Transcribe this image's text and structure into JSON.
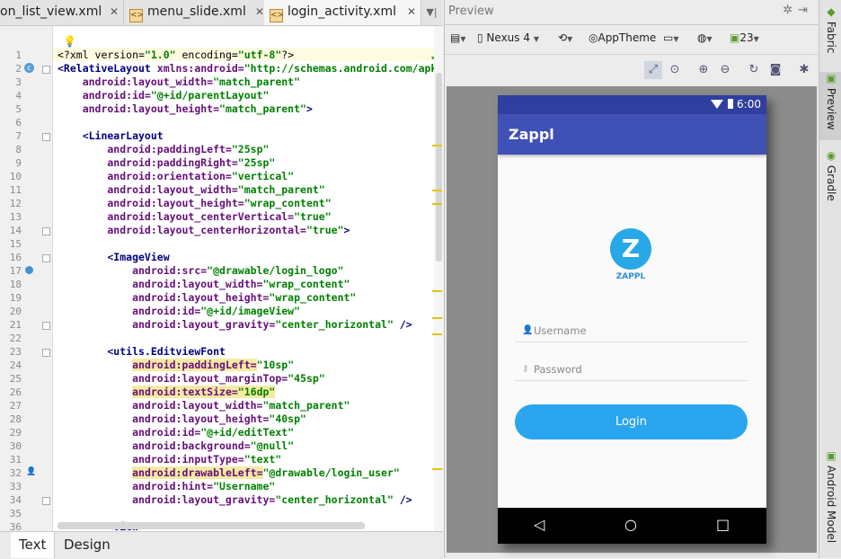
{
  "editor": {
    "tabs": [
      {
        "label": "on_list_view.xml",
        "active": false
      },
      {
        "label": "menu_slide.xml",
        "active": false
      },
      {
        "label": "login_activity.xml",
        "active": true
      }
    ],
    "lines": [
      {
        "n": "1",
        "segs": [
          {
            "t": "<?xml version=",
            "c": "pl"
          },
          {
            "t": "\"1.0\"",
            "c": "vl"
          },
          {
            "t": " encoding=",
            "c": "pl"
          },
          {
            "t": "\"utf-8\"",
            "c": "vl"
          },
          {
            "t": "?>",
            "c": "pl"
          }
        ]
      },
      {
        "n": "2",
        "segs": [
          {
            "t": "<RelativeLayout ",
            "c": "tg"
          },
          {
            "t": "xmlns:android=",
            "c": "at"
          },
          {
            "t": "\"http://schemas.android.com/apk",
            "c": "vl"
          }
        ]
      },
      {
        "n": "3",
        "segs": [
          {
            "t": "    android:layout_width=",
            "c": "at"
          },
          {
            "t": "\"match_parent\"",
            "c": "vl"
          }
        ]
      },
      {
        "n": "4",
        "segs": [
          {
            "t": "    android:id=",
            "c": "at"
          },
          {
            "t": "\"@+id/parentLayout\"",
            "c": "vl"
          }
        ]
      },
      {
        "n": "5",
        "segs": [
          {
            "t": "    android:layout_height=",
            "c": "at"
          },
          {
            "t": "\"match_parent\"",
            "c": "vl"
          },
          {
            "t": ">",
            "c": "tg"
          }
        ]
      },
      {
        "n": "6",
        "segs": []
      },
      {
        "n": "7",
        "segs": [
          {
            "t": "    <LinearLayout",
            "c": "tg"
          }
        ]
      },
      {
        "n": "8",
        "segs": [
          {
            "t": "        android:paddingLeft=",
            "c": "at"
          },
          {
            "t": "\"25sp\"",
            "c": "vl"
          }
        ]
      },
      {
        "n": "9",
        "segs": [
          {
            "t": "        android:paddingRight=",
            "c": "at"
          },
          {
            "t": "\"25sp\"",
            "c": "vl"
          }
        ]
      },
      {
        "n": "10",
        "segs": [
          {
            "t": "        android:orientation=",
            "c": "at"
          },
          {
            "t": "\"vertical\"",
            "c": "vl"
          }
        ]
      },
      {
        "n": "11",
        "segs": [
          {
            "t": "        android:layout_width=",
            "c": "at"
          },
          {
            "t": "\"match_parent\"",
            "c": "vl"
          }
        ]
      },
      {
        "n": "12",
        "segs": [
          {
            "t": "        android:layout_height=",
            "c": "at"
          },
          {
            "t": "\"wrap_content\"",
            "c": "vl"
          }
        ]
      },
      {
        "n": "13",
        "segs": [
          {
            "t": "        android:layout_centerVertical=",
            "c": "at"
          },
          {
            "t": "\"true\"",
            "c": "vl"
          }
        ]
      },
      {
        "n": "14",
        "segs": [
          {
            "t": "        android:layout_centerHorizontal=",
            "c": "at"
          },
          {
            "t": "\"true\"",
            "c": "vl"
          },
          {
            "t": ">",
            "c": "tg"
          }
        ]
      },
      {
        "n": "15",
        "segs": []
      },
      {
        "n": "16",
        "segs": [
          {
            "t": "        <ImageView",
            "c": "tg"
          }
        ]
      },
      {
        "n": "17",
        "segs": [
          {
            "t": "            android:src=",
            "c": "at"
          },
          {
            "t": "\"@drawable/login_logo\"",
            "c": "vl"
          }
        ]
      },
      {
        "n": "18",
        "segs": [
          {
            "t": "            android:layout_width=",
            "c": "at"
          },
          {
            "t": "\"wrap_content\"",
            "c": "vl"
          }
        ]
      },
      {
        "n": "19",
        "segs": [
          {
            "t": "            android:layout_height=",
            "c": "at"
          },
          {
            "t": "\"wrap_content\"",
            "c": "vl"
          }
        ]
      },
      {
        "n": "20",
        "segs": [
          {
            "t": "            android:id=",
            "c": "at"
          },
          {
            "t": "\"@+id/imageView\"",
            "c": "vl"
          }
        ]
      },
      {
        "n": "21",
        "segs": [
          {
            "t": "            android:layout_gravity=",
            "c": "at"
          },
          {
            "t": "\"center_horizontal\"",
            "c": "vl"
          },
          {
            "t": " />",
            "c": "tg"
          }
        ]
      },
      {
        "n": "22",
        "segs": []
      },
      {
        "n": "23",
        "segs": [
          {
            "t": "        <utils.EditviewFont",
            "c": "tg"
          }
        ]
      },
      {
        "n": "24",
        "segs": [
          {
            "t": "            ",
            "c": "pl"
          },
          {
            "t": "android:paddingLeft=",
            "c": "at hl"
          },
          {
            "t": "\"10sp\"",
            "c": "vl"
          }
        ]
      },
      {
        "n": "25",
        "segs": [
          {
            "t": "            android:layout_marginTop=",
            "c": "at"
          },
          {
            "t": "\"45sp\"",
            "c": "vl"
          }
        ]
      },
      {
        "n": "26",
        "segs": [
          {
            "t": "            ",
            "c": "pl"
          },
          {
            "t": "android:textSize=",
            "c": "at hl"
          },
          {
            "t": "\"16dp\"",
            "c": "vl hl"
          }
        ]
      },
      {
        "n": "27",
        "segs": [
          {
            "t": "            android:layout_width=",
            "c": "at"
          },
          {
            "t": "\"match_parent\"",
            "c": "vl"
          }
        ]
      },
      {
        "n": "28",
        "segs": [
          {
            "t": "            android:layout_height=",
            "c": "at"
          },
          {
            "t": "\"40sp\"",
            "c": "vl"
          }
        ]
      },
      {
        "n": "29",
        "segs": [
          {
            "t": "            android:id=",
            "c": "at"
          },
          {
            "t": "\"@+id/editText\"",
            "c": "vl"
          }
        ]
      },
      {
        "n": "30",
        "segs": [
          {
            "t": "            android:background=",
            "c": "at"
          },
          {
            "t": "\"@null\"",
            "c": "vl"
          }
        ]
      },
      {
        "n": "31",
        "segs": [
          {
            "t": "            android:inputType=",
            "c": "at"
          },
          {
            "t": "\"text\"",
            "c": "vl"
          }
        ]
      },
      {
        "n": "32",
        "segs": [
          {
            "t": "            ",
            "c": "pl"
          },
          {
            "t": "android:drawableLeft=",
            "c": "at hl"
          },
          {
            "t": "\"@drawable/login_user\"",
            "c": "vl"
          }
        ]
      },
      {
        "n": "33",
        "segs": [
          {
            "t": "            android:hint=",
            "c": "at"
          },
          {
            "t": "\"Username\"",
            "c": "vl"
          }
        ]
      },
      {
        "n": "34",
        "segs": [
          {
            "t": "            android:layout_gravity=",
            "c": "at"
          },
          {
            "t": "\"center_horizontal\"",
            "c": "vl"
          },
          {
            "t": " />",
            "c": "tg"
          }
        ]
      },
      {
        "n": "35",
        "segs": []
      },
      {
        "n": "36",
        "segs": [
          {
            "t": "        <View",
            "c": "tg"
          }
        ]
      }
    ],
    "bottom_tabs": [
      "Text",
      "Design"
    ]
  },
  "preview": {
    "title": "Preview",
    "device": "Nexus 4",
    "theme": "AppTheme",
    "api": "23",
    "phone": {
      "time": "6:00",
      "app_title": "Zappl",
      "logo_text": "ZAPPL",
      "username_hint": "Username",
      "password_hint": "Password",
      "login_label": "Login"
    }
  },
  "side_tabs": [
    "Fabric",
    "Preview",
    "Gradle",
    "Android Model"
  ],
  "colors": {
    "primary": "#3f51b5",
    "primary_dark": "#303f9f",
    "button": "#2aa5ee"
  }
}
